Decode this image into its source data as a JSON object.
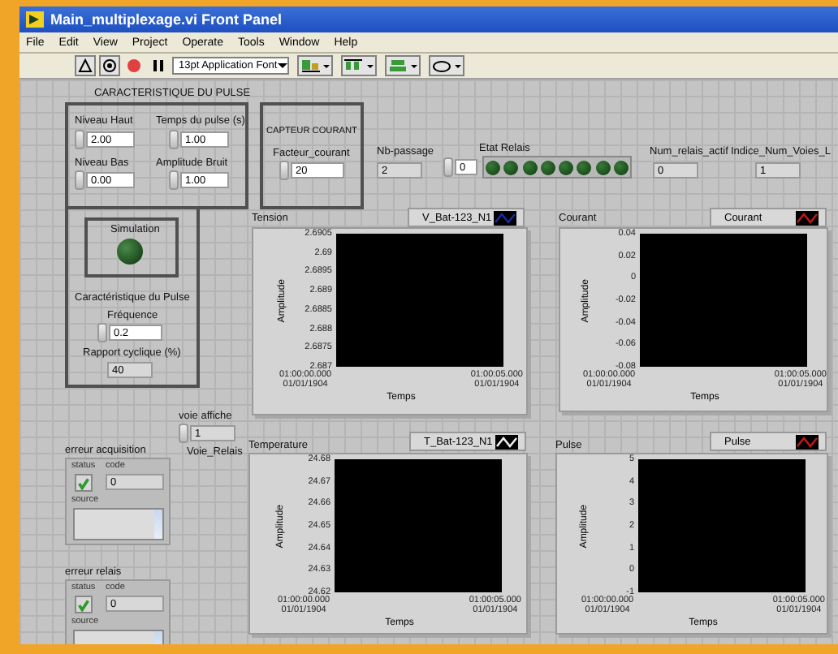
{
  "window": {
    "title": "Main_multiplexage.vi Front Panel"
  },
  "menu": [
    "File",
    "Edit",
    "View",
    "Project",
    "Operate",
    "Tools",
    "Window",
    "Help"
  ],
  "toolbar": {
    "font": "13pt Application Font"
  },
  "pulse_group": {
    "title": "CARACTERISTIQUE DU PULSE",
    "controls": [
      {
        "label": "Niveau Haut",
        "value": "2.00"
      },
      {
        "label": "Temps du pulse (s)",
        "value": "1.00"
      },
      {
        "label": "Niveau Bas",
        "value": "0.00"
      },
      {
        "label": "Amplitude Bruit",
        "value": "1.00"
      }
    ]
  },
  "capteur": {
    "title": "CAPTEUR COURANT",
    "label": "Facteur_courant",
    "value": "20"
  },
  "nb_passage": {
    "label": "Nb-passage",
    "value": "2"
  },
  "relay_index": {
    "value": "0"
  },
  "etat_relais": {
    "label": "Etat Relais",
    "leds": [
      {
        "on": false
      },
      {
        "on": false
      },
      {
        "on": false
      },
      {
        "on": false
      },
      {
        "on": false
      },
      {
        "on": false
      },
      {
        "on": false
      },
      {
        "on": false
      }
    ]
  },
  "num_relais_actif": {
    "label": "Num_relais_actif",
    "value": "0"
  },
  "indice": {
    "label": "Indice_Num_Voies_L",
    "value": "1"
  },
  "simulation": {
    "label": "Simulation",
    "on": false
  },
  "caracteristique": {
    "title": "Caractéristique du Pulse",
    "frequence_label": "Fréquence",
    "frequence": "0.2",
    "rapport_label": "Rapport cyclique (%)",
    "rapport": "40"
  },
  "voie": {
    "label": "voie affiche",
    "value": "1",
    "caption": "Voie_Relais"
  },
  "errors": [
    {
      "title": "erreur acquisition",
      "status_label": "status",
      "code_label": "code",
      "code": "0",
      "source_label": "source",
      "ok": true
    },
    {
      "title": "erreur relais",
      "status_label": "status",
      "code_label": "code",
      "code": "0",
      "source_label": "source",
      "ok": true
    }
  ],
  "graphs": [
    {
      "title": "Tension",
      "legend": "V_Bat-123_N1",
      "color": "#1a2a9a",
      "ylabel": "Amplitude",
      "xlabel": "Temps",
      "yticks": [
        "2.6905",
        "2.69",
        "2.6895",
        "2.689",
        "2.6885",
        "2.688",
        "2.6875",
        "2.687"
      ],
      "xticks": [
        {
          "time": "01:00:00.000",
          "date": "01/01/1904"
        },
        {
          "time": "01:00:05.000",
          "date": "01/01/1904"
        }
      ]
    },
    {
      "title": "Courant",
      "legend": "Courant",
      "color": "#c01818",
      "ylabel": "Amplitude",
      "xlabel": "Temps",
      "yticks": [
        "0.04",
        "0.02",
        "0",
        "-0.02",
        "-0.04",
        "-0.06",
        "-0.08"
      ],
      "xticks": [
        {
          "time": "01:00:00.000",
          "date": "01/01/1904"
        },
        {
          "time": "01:00:05.000",
          "date": "01/01/1904"
        }
      ]
    },
    {
      "title": "Temperature",
      "legend": "T_Bat-123_N1",
      "color": "#f0f0f0",
      "ylabel": "Amplitude",
      "xlabel": "Temps",
      "yticks": [
        "24.68",
        "24.67",
        "24.66",
        "24.65",
        "24.64",
        "24.63",
        "24.62"
      ],
      "xticks": [
        {
          "time": "01:00:00.000",
          "date": "01/01/1904"
        },
        {
          "time": "01:00:05.000",
          "date": "01/01/1904"
        }
      ]
    },
    {
      "title": "Pulse",
      "legend": "Pulse",
      "color": "#c01818",
      "ylabel": "Amplitude",
      "xlabel": "Temps",
      "yticks": [
        "5",
        "4",
        "3",
        "2",
        "1",
        "0",
        "-1"
      ],
      "xticks": [
        {
          "time": "01:00:00.000",
          "date": "01/01/1904"
        },
        {
          "time": "01:00:05.000",
          "date": "01/01/1904"
        }
      ]
    }
  ]
}
